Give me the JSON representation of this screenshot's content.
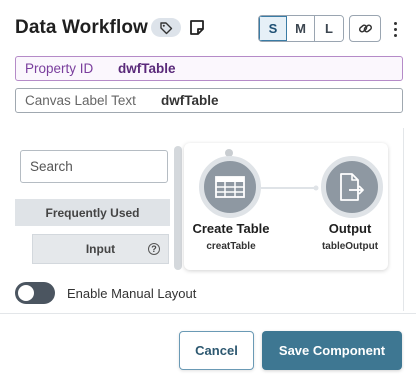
{
  "header": {
    "title": "Data Workflow",
    "icons": [
      "tag-icon",
      "sticky-note-icon",
      "link-icon",
      "more-vertical-icon"
    ],
    "size_buttons": [
      {
        "label": "S",
        "active": true
      },
      {
        "label": "M",
        "active": false
      },
      {
        "label": "L",
        "active": false
      }
    ]
  },
  "properties": {
    "property_id": {
      "label": "Property ID",
      "value": "dwfTable"
    },
    "canvas_label": {
      "label": "Canvas Label Text",
      "value": "dwfTable"
    }
  },
  "palette": {
    "search_placeholder": "Search",
    "section": "Frequently Used",
    "items": [
      {
        "label": "Input",
        "help_icon": "help-circle-icon",
        "help_glyph": "?"
      }
    ]
  },
  "workflow": {
    "nodes": [
      {
        "title": "Create Table",
        "subtitle": "creatTable",
        "icon": "table-icon"
      },
      {
        "title": "Output",
        "subtitle": "tableOutput",
        "icon": "file-export-icon"
      }
    ]
  },
  "manual_layout": {
    "label": "Enable Manual Layout",
    "enabled": false
  },
  "footer": {
    "cancel_label": "Cancel",
    "save_label": "Save Component"
  },
  "colors": {
    "primary": "#3e7792",
    "property_accent": "#7a3e9d",
    "node_fill": "#8e98a2",
    "toggle_off": "#4b5560"
  }
}
